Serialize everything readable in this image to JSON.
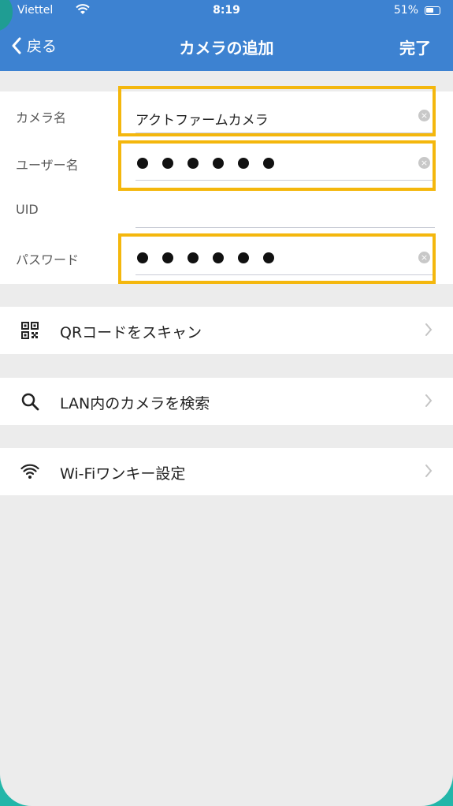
{
  "status_bar": {
    "carrier": "Viettel",
    "time": "8:19",
    "battery": "51%"
  },
  "nav": {
    "back_label": "戻る",
    "title": "カメラの追加",
    "done_label": "完了"
  },
  "form": {
    "camera_name_label": "カメラ名",
    "camera_name_value": "アクトファームカメラ",
    "username_label": "ユーザー名",
    "uid_label": "UID",
    "password_label": "パスワード"
  },
  "menu": {
    "qr_label": "QRコードをスキャン",
    "lan_label": "LAN内のカメラを検索",
    "wifi_label": "Wi-Fiワンキー設定"
  },
  "colors": {
    "header": "#3d82d1",
    "highlight": "#f4b70d",
    "frame": "#23b6a9"
  },
  "icons": [
    "back-chevron-icon",
    "clear-icon",
    "qr-code-icon",
    "search-icon",
    "wifi-icon",
    "chevron-right-icon"
  ]
}
